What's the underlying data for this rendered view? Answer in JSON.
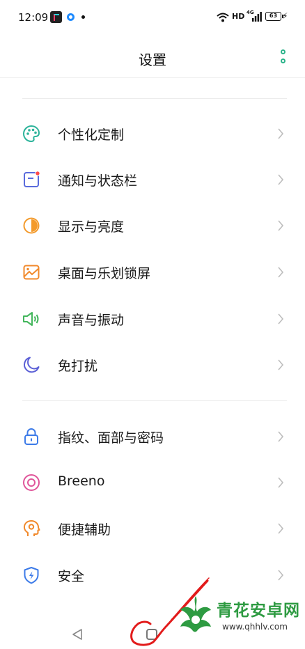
{
  "status_bar": {
    "time": "12:09",
    "hd_label": "HD",
    "network_label": "4G",
    "battery_level": "63",
    "icons": [
      "video-app-notification-icon",
      "browser-notification-icon",
      "more-notifications-dot",
      "wifi-icon",
      "signal-icon",
      "battery-icon",
      "charging-icon"
    ]
  },
  "header": {
    "title": "设置",
    "more_icon": "vertical-dots-icon"
  },
  "settings_groups": [
    [
      {
        "label": "个性化定制",
        "icon": "palette-icon",
        "color": "#2bb39a"
      },
      {
        "label": "通知与状态栏",
        "icon": "notification-bar-icon",
        "color": "#5a6bdc"
      },
      {
        "label": "显示与亮度",
        "icon": "brightness-icon",
        "color": "#f39a2b"
      },
      {
        "label": "桌面与乐划锁屏",
        "icon": "wallpaper-icon",
        "color": "#f1892b"
      },
      {
        "label": "声音与振动",
        "icon": "speaker-icon",
        "color": "#43b65c"
      },
      {
        "label": "免打扰",
        "icon": "moon-icon",
        "color": "#5b5fd6"
      }
    ],
    [
      {
        "label": "指纹、面部与密码",
        "icon": "lock-icon",
        "color": "#3d7be8"
      },
      {
        "label": "Breeno",
        "icon": "breeno-icon",
        "color": "#e0559a"
      },
      {
        "label": "便捷辅助",
        "icon": "assist-head-icon",
        "color": "#f1892b"
      },
      {
        "label": "安全",
        "icon": "shield-icon",
        "color": "#3d7be8"
      }
    ]
  ],
  "nav_bar": {
    "icons": [
      "back-icon",
      "home-icon"
    ]
  },
  "watermark": {
    "name": "青花安卓网",
    "url": "www.qhhlv.com"
  },
  "colors": {
    "accent": "#2bb38a",
    "annotation": "#e21b1b",
    "watermark": "#2e9b42"
  }
}
